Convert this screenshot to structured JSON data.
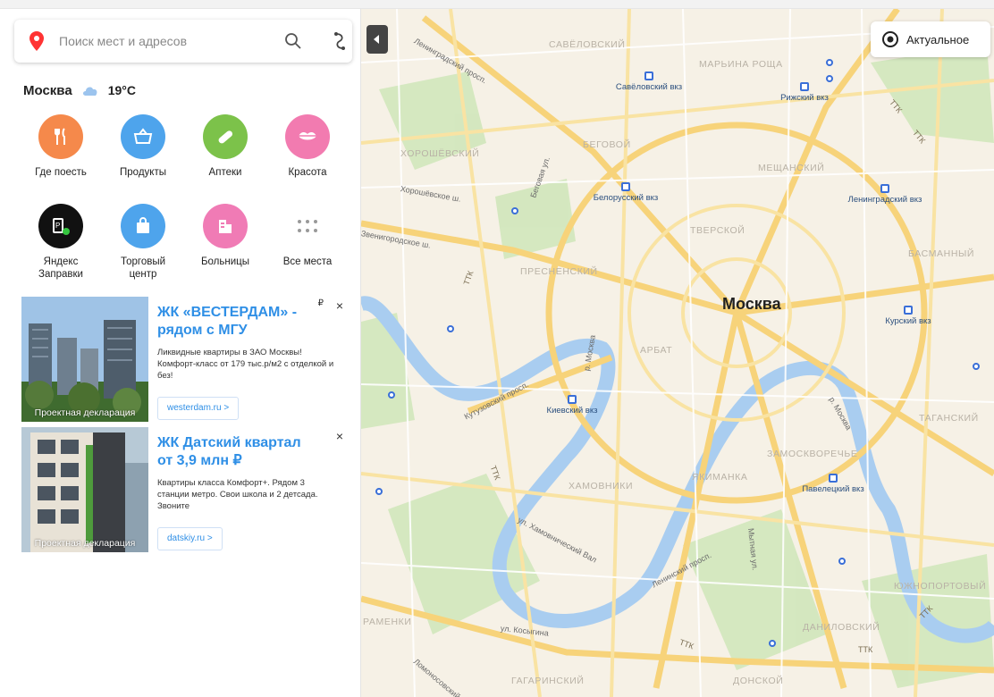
{
  "search": {
    "placeholder": "Поиск мест и адресов"
  },
  "weather": {
    "city": "Москва",
    "temp": "19°C"
  },
  "categories": [
    {
      "label": "Где поесть",
      "color": "#f5894b",
      "icon": "fork-knife-icon"
    },
    {
      "label": "Продукты",
      "color": "#4ea4ec",
      "icon": "basket-icon"
    },
    {
      "label": "Аптеки",
      "color": "#7cc24a",
      "icon": "pill-icon"
    },
    {
      "label": "Красота",
      "color": "#f27bb0",
      "icon": "lips-icon"
    },
    {
      "label": "Яндекс\nЗаправки",
      "color": "#111111",
      "icon": "fuel-icon"
    },
    {
      "label": "Торговый\nцентр",
      "color": "#4ea4ec",
      "icon": "shopping-bag-icon"
    },
    {
      "label": "Больницы",
      "color": "#f07bb5",
      "icon": "hospital-icon"
    },
    {
      "label": "Все места",
      "color": "#ffffff",
      "icon": "grid-dots-icon"
    }
  ],
  "ads": [
    {
      "title": "ЖК «ВЕСТЕРДАМ» - рядом с МГУ",
      "desc": "Ликвидные квартиры в ЗАО Москвы! Комфорт-класс от 179 тыс.р/м2 с отделкой и без!",
      "link": "westerdam.ru >",
      "declaration": "Проектная декларация",
      "ruble": "₽",
      "close": "×"
    },
    {
      "title": "ЖК Датский квартал от 3,9 млн ₽",
      "desc": "Квартиры класса Комфорт+. Рядом 3 станции метро. Свои школа и 2 детсада. Звоните",
      "link": "datskiy.ru >",
      "declaration": "Проектная декларация",
      "close": "×"
    }
  ],
  "map": {
    "actual_button": "Актуальное",
    "city_label": "Москва",
    "districts": [
      "САВЁЛОВСКИЙ",
      "МАРЬИНА РОЩА",
      "ХОРОШЁВСКИЙ",
      "БЕГОВОЙ",
      "МЕЩАНСКИЙ",
      "ТВЕРСКОЙ",
      "ПРЕСНЕНСКИЙ",
      "БАСМАННЫЙ",
      "АРБАТ",
      "ТАГАНСКИЙ",
      "ЗАМОСКВОРЕЧЬЕ",
      "ЯКИМАНКА",
      "ХАМОВНИКИ",
      "ЮЖНОПОРТОВЫЙ",
      "ДАНИЛОВСКИЙ",
      "ДОНСКОЙ",
      "ГАГАРИНСКИЙ",
      "РАМЕНКИ"
    ],
    "stations": [
      "Савёловский вкз",
      "Рижский вкз",
      "Белорусский вкз",
      "Ленинградский вкз",
      "Курский вкз",
      "Киевский вкз",
      "Павелецкий вкз"
    ],
    "streets": [
      "Ленинградский просп.",
      "Хорошёвское ш.",
      "Звенигородское ш.",
      "Беговая ул.",
      "Кутузовский просп.",
      "ул. Хамовнический Вал",
      "ул. Косыгина",
      "Мичуринский просп.",
      "р. Москва",
      "р. Москва",
      "Ленинский просп.",
      "Мытная ул.",
      "Ломоносовский просп."
    ],
    "ttk": "ТТК"
  }
}
